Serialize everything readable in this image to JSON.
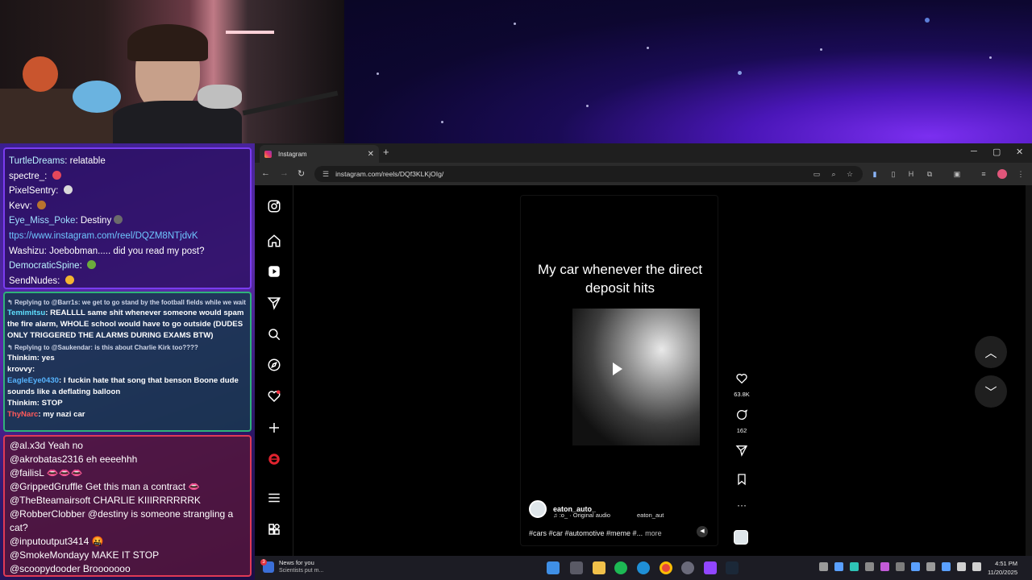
{
  "chat_top": [
    {
      "user": "TurtleDreams",
      "message": "relatable",
      "user_color": "#b9f2ff",
      "emote": ""
    },
    {
      "user": "spectre_",
      "message": "",
      "user_color": "#ffffff",
      "emote": "#e4475b"
    },
    {
      "user": "PixelSentry",
      "message": "",
      "user_color": "#ffffff",
      "emote": "#d9d9d9"
    },
    {
      "user": "Kevv",
      "message": "",
      "user_color": "#ffffff",
      "emote": "#b8732e"
    },
    {
      "user": "Eye_Miss_Poke",
      "message": "Destiny",
      "user_color": "#9fe0ff",
      "emote": "#6b6b6b"
    },
    {
      "user": "",
      "message": "ttps://www.instagram.com/reel/DQZM8NTjdvK",
      "user_color": "#6fc6ff",
      "emote": ""
    },
    {
      "user": "Washizu",
      "message": "Joebobman..... did you read my post?",
      "user_color": "#ffffff",
      "emote": ""
    },
    {
      "user": "DemocraticSpine",
      "message": "",
      "user_color": "#b9f2ff",
      "emote": "#6cab3c"
    },
    {
      "user": "SendNudes",
      "message": "",
      "user_color": "#ffffff",
      "emote": "#f3b531"
    }
  ],
  "chat_mid": [
    {
      "reply": "Replying to @Barr1s: we get to go stand by the football fields while we wait fo...",
      "user": "",
      "message": ""
    },
    {
      "reply": "",
      "user": "Temimitsu",
      "message": "REALLLL same shit whenever someone would spam the fire alarm, WHOLE school would have to go outside (DUDES ONLY TRIGGERED THE ALARMS DURING EXAMS BTW)",
      "color": "#5fe0ff"
    },
    {
      "reply": "Replying to @Saukendar: is this about Charlie Kirk too????",
      "user": "",
      "message": ""
    },
    {
      "reply": "",
      "user": "Thinkim",
      "message": "yes",
      "color": "#ffffff"
    },
    {
      "reply": "",
      "user": "krovvy",
      "message": "",
      "color": "#ffffff"
    },
    {
      "reply": "",
      "user": "EagleEye0430",
      "message": "I fuckin hate that song that benson Boone dude sounds like a deflating balloon",
      "color": "#56b4ff"
    },
    {
      "reply": "",
      "user": "Thinkim",
      "message": "STOP",
      "color": "#ffffff"
    },
    {
      "reply": "",
      "user": "ThyNarc",
      "message": "my nazi car",
      "color": "#ff5a5a"
    }
  ],
  "chat_bottom": [
    "@al.x3d Yeah no",
    "@akrobatas2316 eh eeeehhh",
    "@failisL 👄👄👄",
    "@GrippedGruffle Get this man a contract 👄",
    "@TheBteamairsoft CHARLIE KIIIRRRRRRK",
    "@RobberClobber @destiny is someone strangling a cat?",
    "@inputoutput3414 🤬",
    "@SmokeMondayy MAKE IT STOP",
    "@scoopydooder Brooooooo"
  ],
  "browser": {
    "tab_title": "Instagram",
    "tab_close": "✕",
    "new_tab": "+",
    "url": "instagram.com/reels/DQf3KLKjOIg/",
    "win_min": "─",
    "win_max": "▢",
    "win_close": "✕",
    "back": "←",
    "forward": "→",
    "reload": "↻"
  },
  "reel": {
    "caption": "My car whenever the direct deposit hits",
    "author": "eaton_auto_",
    "audio": "♫ :o_ · Original audio",
    "audio_secondary": "eaton_aut",
    "tags": "#cars #car #automotive #meme #...",
    "more": "more",
    "likes": "63.8K",
    "comments": "162"
  },
  "taskbar": {
    "news_badge": "3",
    "news_title": "News for you",
    "news_sub": "Scientists put m...",
    "time": "4:51 PM",
    "date": "11/20/2025"
  },
  "colors": {
    "accent_chat1": "#7a3cf0",
    "accent_chat2": "#2fb27a",
    "accent_chat3": "#e03a55"
  }
}
